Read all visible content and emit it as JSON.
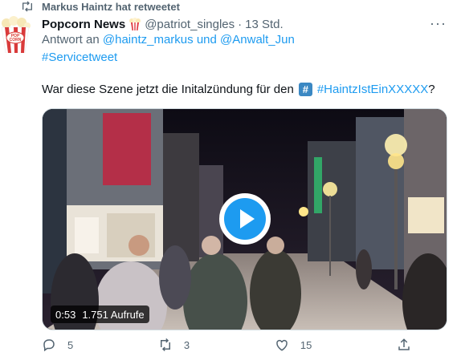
{
  "retweet": {
    "label": "Markus Haintz hat retweetet",
    "icon": "retweet-icon"
  },
  "tweet": {
    "avatar": {
      "badge_text": "POP CORN",
      "icon": "popcorn-bucket-icon"
    },
    "author": {
      "display_name": "Popcorn News",
      "emoji": "popcorn-emoji",
      "handle": "@patriot_singles",
      "separator": "·",
      "time": "13 Std."
    },
    "more_label": "···",
    "reply": {
      "prefix": "Antwort an ",
      "mention_1": "@haintz_markus",
      "conjunction": " und ",
      "mention_2": "@Anwalt_Jun"
    },
    "hashtag_line": "#Servicetweet",
    "text": {
      "body": "War diese Szene jetzt die Initalzündung für den",
      "hash_emoji": "#",
      "hashtag": "#HaintzIstEinXXXXX",
      "suffix": "?"
    },
    "video": {
      "duration": "0:53",
      "views": "1.751 Aufrufe",
      "play_icon": "play-icon"
    },
    "actions": {
      "reply_count": "5",
      "retweet_count": "3",
      "like_count": "15",
      "share_icon": "share-icon"
    }
  },
  "colors": {
    "accent": "#1d9bf0",
    "secondary_text": "#536471",
    "primary_text": "#0f1419"
  }
}
